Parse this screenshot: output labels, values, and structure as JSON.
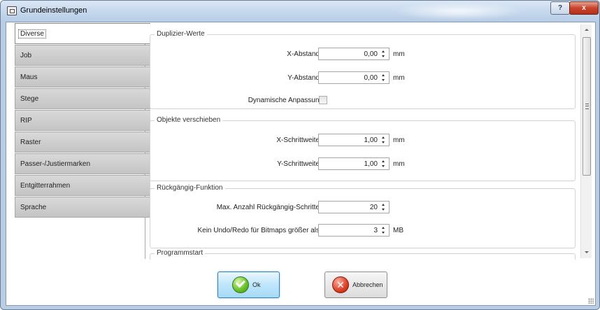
{
  "window": {
    "title": "Grundeinstellungen",
    "help_label": "?",
    "close_label": "x"
  },
  "tabs": [
    {
      "label": "Diverse",
      "active": true
    },
    {
      "label": "Job"
    },
    {
      "label": "Maus"
    },
    {
      "label": "Stege"
    },
    {
      "label": "RIP"
    },
    {
      "label": "Raster"
    },
    {
      "label": "Passer-/Justiermarken"
    },
    {
      "label": "Entgitterrahmen"
    },
    {
      "label": "Sprache"
    }
  ],
  "groups": {
    "duplizier": {
      "title": "Duplizier-Werte",
      "x_label": "X-Abstand",
      "x_value": "0,00",
      "x_unit": "mm",
      "y_label": "Y-Abstand",
      "y_value": "0,00",
      "y_unit": "mm",
      "dyn_label": "Dynamische Anpassung",
      "dyn_checked": false
    },
    "verschieben": {
      "title": "Objekte verschieben",
      "x_label": "X-Schrittweite",
      "x_value": "1,00",
      "x_unit": "mm",
      "y_label": "Y-Schrittweite",
      "y_value": "1,00",
      "y_unit": "mm"
    },
    "undo": {
      "title": "Rückgängig-Funktion",
      "max_label": "Max. Anzahl Rückgängig-Schritte",
      "max_value": "20",
      "bitmap_label": "Kein Undo/Redo für Bitmaps größer als",
      "bitmap_value": "3",
      "bitmap_unit": "MB"
    },
    "programmstart": {
      "title": "Programmstart"
    }
  },
  "buttons": {
    "ok": "Ok",
    "cancel": "Abbrechen"
  },
  "colors": {
    "accent": "#3c7fb1",
    "ok_green": "#6cc42c",
    "cancel_red": "#e0472c"
  },
  "icons": {
    "app": "settings-app-icon",
    "ok": "checkmark-icon",
    "cancel": "x-cross-icon"
  }
}
